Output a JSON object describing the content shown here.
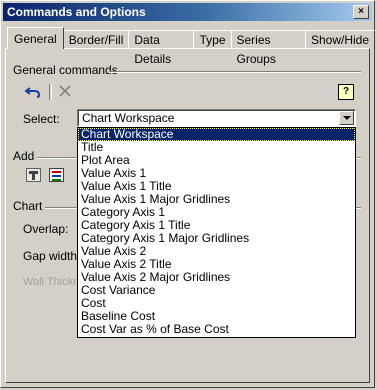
{
  "window": {
    "title": "Commands and Options",
    "close_label": "×"
  },
  "tabs": [
    {
      "label": "General",
      "active": true
    },
    {
      "label": "Border/Fill",
      "active": false
    },
    {
      "label": "Data Details",
      "active": false
    },
    {
      "label": "Type",
      "active": false
    },
    {
      "label": "Series Groups",
      "active": false
    },
    {
      "label": "Show/Hide",
      "active": false
    }
  ],
  "general_commands": {
    "heading": "General commands",
    "undo_icon": "undo-icon",
    "delete_icon": "delete-icon",
    "help_icon": "help-icon",
    "help_glyph": "?",
    "select_label": "Select:",
    "select_value": "Chart Workspace"
  },
  "add_section": {
    "heading": "Add"
  },
  "chart_section": {
    "heading": "Chart",
    "overlap_label": "Overlap:",
    "gap_width_label": "Gap width:",
    "wall_thickness_label": "Wall Thickn"
  },
  "dropdown": {
    "items": [
      "Chart Workspace",
      "Title",
      "Plot Area",
      "Value Axis 1",
      "Value Axis 1 Title",
      "Value Axis 1 Major Gridlines",
      "Category Axis 1",
      "Category Axis 1 Title",
      "Category Axis 1 Major Gridlines",
      "Value Axis 2",
      "Value Axis 2 Title",
      "Value Axis 2 Major Gridlines",
      "Cost Variance",
      "Cost",
      "Baseline Cost",
      "Cost Var as % of Base Cost"
    ],
    "selected_index": 0
  },
  "colors": {
    "titlebar": "#0a246a",
    "selection": "#0a246a",
    "face": "#d4d0c8"
  }
}
